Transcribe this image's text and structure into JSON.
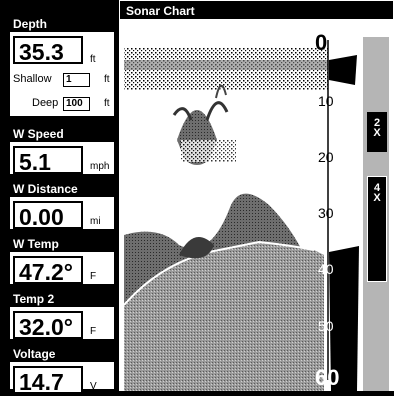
{
  "depth": {
    "title": "Depth",
    "value": "35.3",
    "unit": "ft",
    "shallow_label": "Shallow",
    "shallow_value": "1",
    "shallow_unit": "ft",
    "deep_label": "Deep",
    "deep_value": "100",
    "deep_unit": "ft"
  },
  "speed": {
    "title": "W Speed",
    "value": "5.1",
    "unit": "mph"
  },
  "distance": {
    "title": "W Distance",
    "value": "0.00",
    "unit": "mi"
  },
  "temp": {
    "title": "W Temp",
    "value": "47.2°",
    "unit": "F"
  },
  "temp2": {
    "title": "Temp 2",
    "value": "32.0°",
    "unit": "F"
  },
  "voltage": {
    "title": "Voltage",
    "value": "14.7",
    "unit": "V"
  },
  "chart": {
    "title": "Sonar Chart",
    "depth_labels": [
      "0",
      "10",
      "20",
      "30",
      "40",
      "50",
      "60"
    ],
    "zoom_2x": "2\nX",
    "zoom_4x": "4\nX"
  },
  "colors": {
    "background": "#ffffff",
    "sidebar": "#000000",
    "bottom_dark": "#555555",
    "bottom_mid": "#8a8a8a",
    "fish": "#6b6b6b"
  }
}
